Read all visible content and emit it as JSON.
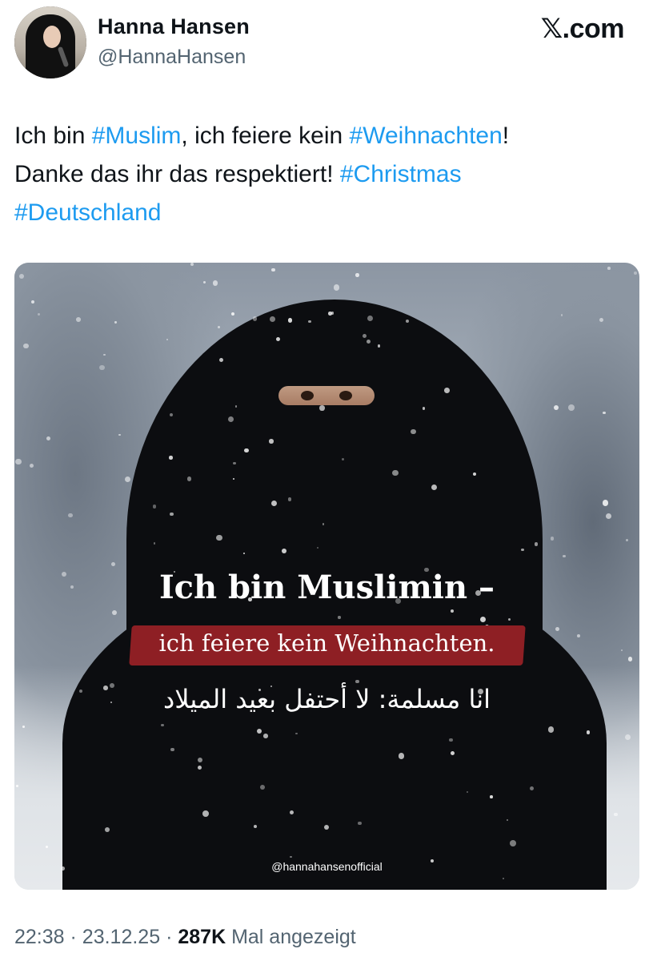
{
  "author": {
    "name": "Hanna Hansen",
    "handle": "@HannaHansen",
    "avatar_icon": "profile-photo"
  },
  "site": {
    "logo_text": "𝕏.com"
  },
  "tweet": {
    "segments": [
      {
        "text": "Ich bin ",
        "hashtag": false
      },
      {
        "text": "#Muslim",
        "hashtag": true
      },
      {
        "text": ", ich feiere kein ",
        "hashtag": false
      },
      {
        "text": "#Weihnachten",
        "hashtag": true
      },
      {
        "text": "!",
        "hashtag": false
      },
      {
        "text": "Danke das ihr das respektiert! ",
        "hashtag": false
      },
      {
        "text": "#Christmas",
        "hashtag": true
      },
      {
        "text": "#Deutschland",
        "hashtag": true
      }
    ],
    "hashtag_color": "#1d9bf0"
  },
  "media": {
    "headline": "Ich bin Muslimin –",
    "subline": "ich feiere kein Weihnachten.",
    "arabic": "انا مسلمة: لا أحتفل بعيد الميلاد",
    "credit": "@hannahansenofficial",
    "banner_color": "#8e1f24"
  },
  "meta": {
    "time": "22:38",
    "separator": "·",
    "date": "23.12.25",
    "views": "287K",
    "views_label": "Mal angezeigt"
  }
}
